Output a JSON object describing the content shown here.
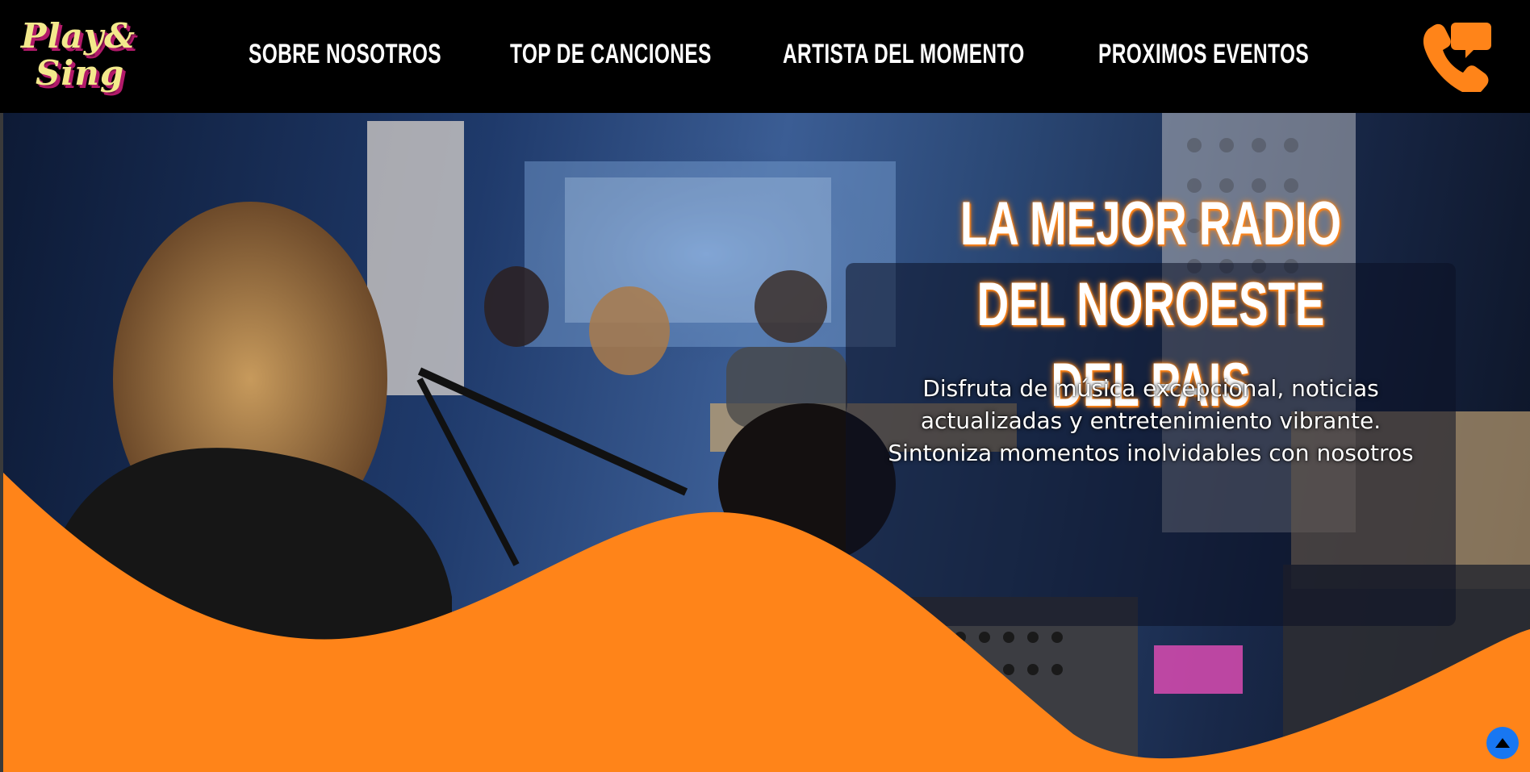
{
  "brand": {
    "logo_line1": "Play&",
    "logo_line2": "Sing"
  },
  "nav": {
    "items": [
      {
        "label": "SOBRE NOSOTROS"
      },
      {
        "label": "TOP DE CANCIONES"
      },
      {
        "label": "ARTISTA DEL MOMENTO"
      },
      {
        "label": "PROXIMOS EVENTOS"
      }
    ]
  },
  "hero": {
    "title_line1": "LA MEJOR RADIO DEL NOROESTE",
    "title_line2": "DEL PAIS",
    "subtitle": "Disfruta de música excepcional, noticias actualizadas y entretenimiento vibrante. Sintoniza momentos inolvidables con nosotros"
  },
  "icons": {
    "contact": "phone-chat-icon",
    "scroll_top": "arrow-up-icon"
  },
  "colors": {
    "accent_orange": "#ff8419",
    "logo_yellow": "#f3e98c",
    "logo_shadow": "#b21a6a",
    "header_bg": "#000000",
    "scroll_button": "#1877f2"
  }
}
